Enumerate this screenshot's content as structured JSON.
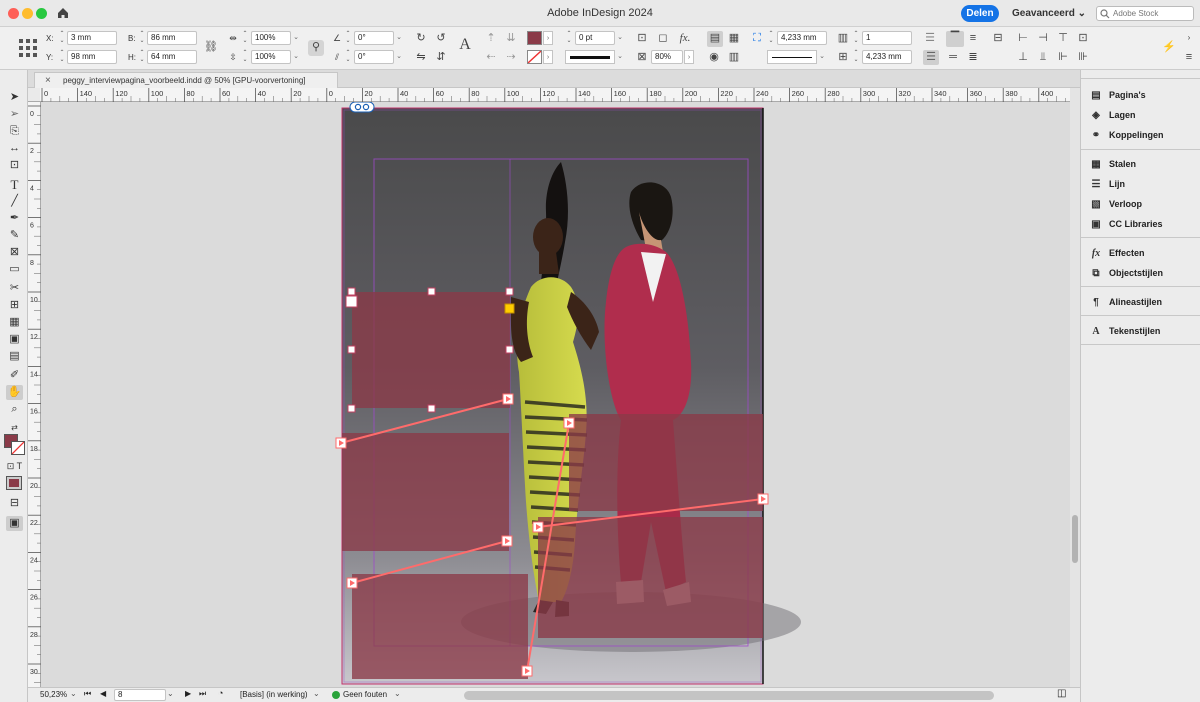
{
  "app": {
    "title": "Adobe InDesign 2024",
    "share_label": "Delen",
    "workspace_label": "Geavanceerd",
    "stock_placeholder": "Adobe Stock"
  },
  "control": {
    "x_label": "X:",
    "x_value": "3 mm",
    "y_label": "Y:",
    "y_value": "98 mm",
    "w_label": "B:",
    "w_value": "86 mm",
    "h_label": "H:",
    "h_value": "64 mm",
    "scale_x": "100%",
    "scale_y": "100%",
    "angle": "0°",
    "shear": "0°",
    "stroke_weight": "0 pt",
    "opacity": "80%",
    "dim1": "4,233 mm",
    "dim2": "4,233 mm",
    "columns": "1",
    "fill_color": "#8a3a48"
  },
  "document": {
    "tab_label": "peggy_interviewpagina_voorbeeld.indd @ 50% [GPU-voorvertoning]",
    "close_glyph": "×"
  },
  "ruler": {
    "h_ticks": [
      "0",
      "140",
      "120",
      "100",
      "80",
      "60",
      "40",
      "20",
      "0",
      "20",
      "40",
      "60",
      "80",
      "100",
      "120",
      "140",
      "160",
      "180",
      "200",
      "220",
      "240",
      "260",
      "280",
      "300",
      "320",
      "340",
      "360",
      "380",
      "400"
    ],
    "v_ticks": [
      "0",
      "2",
      "4",
      "6",
      "8",
      "10",
      "12",
      "14",
      "16",
      "18",
      "20",
      "22",
      "24",
      "26",
      "28",
      "30"
    ]
  },
  "status": {
    "zoom": "50,23%",
    "page": "8",
    "style": "[Basis] (in werking)",
    "errors": "Geen fouten"
  },
  "panels": [
    {
      "label": "Pagina's",
      "icon": "pages-icon"
    },
    {
      "label": "Lagen",
      "icon": "layers-icon"
    },
    {
      "label": "Koppelingen",
      "icon": "links-icon"
    },
    {
      "label": "Stalen",
      "icon": "swatches-icon"
    },
    {
      "label": "Lijn",
      "icon": "stroke-icon"
    },
    {
      "label": "Verloop",
      "icon": "gradient-icon"
    },
    {
      "label": "CC Libraries",
      "icon": "libraries-icon"
    },
    {
      "label": "Effecten",
      "icon": "fx-icon"
    },
    {
      "label": "Objectstijlen",
      "icon": "object-styles-icon"
    },
    {
      "label": "Alineastijlen",
      "icon": "paragraph-styles-icon"
    },
    {
      "label": "Tekenstijlen",
      "icon": "character-styles-icon"
    }
  ],
  "colors": {
    "frame_fill": "#8a3a48",
    "thread_line": "#ff6b6b",
    "accent": "#1473e6"
  }
}
